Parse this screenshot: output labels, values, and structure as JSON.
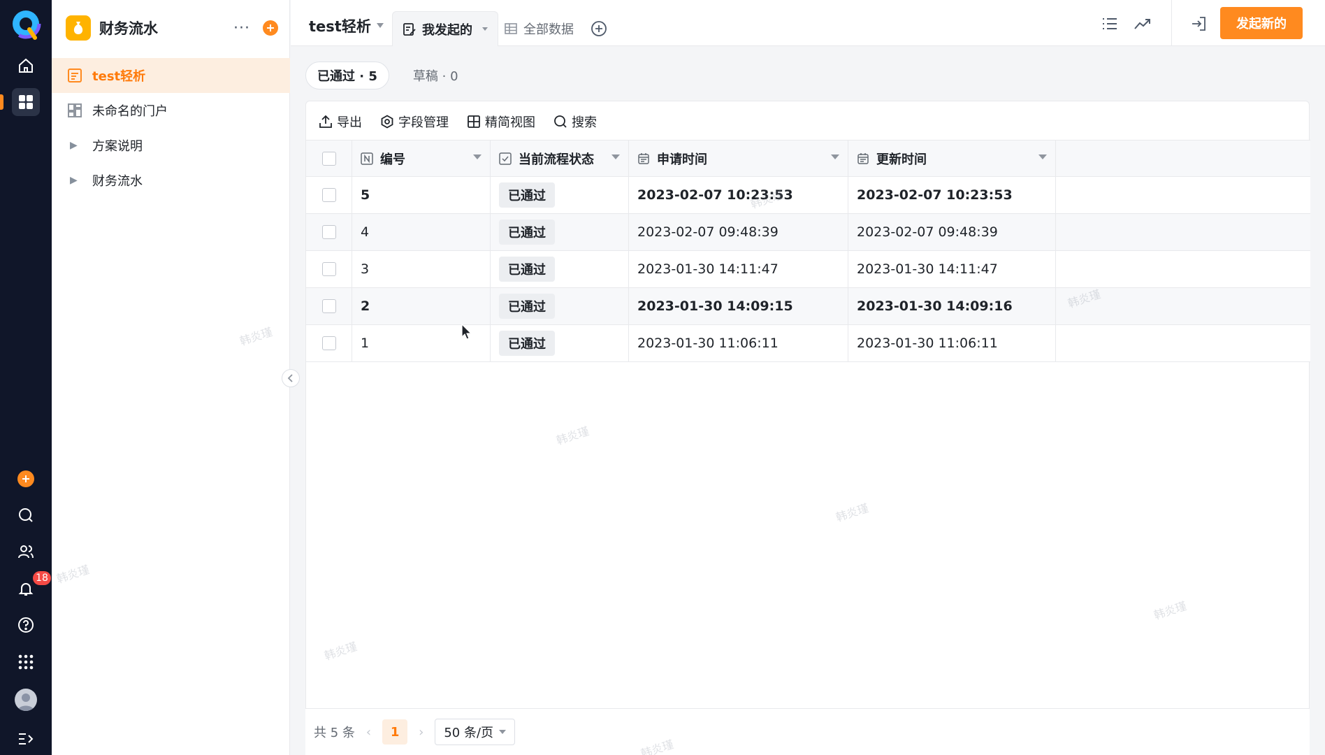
{
  "rail": {
    "notification_count": "18"
  },
  "nav": {
    "app_title": "财务流水",
    "items": [
      {
        "label": "test轻析"
      },
      {
        "label": "未命名的门户"
      },
      {
        "label": "方案说明"
      },
      {
        "label": "财务流水"
      }
    ]
  },
  "topbar": {
    "form_name": "test轻析",
    "tabs": [
      {
        "label": "我发起的"
      },
      {
        "label": "全部数据"
      }
    ],
    "primary_button": "发起新的"
  },
  "filters": [
    {
      "label": "已通过 · 5"
    },
    {
      "label": "草稿 · 0"
    }
  ],
  "toolbar": {
    "export": "导出",
    "fields": "字段管理",
    "compact_view": "精简视图",
    "search": "搜索"
  },
  "table": {
    "columns": [
      "编号",
      "当前流程状态",
      "申请时间",
      "更新时间"
    ],
    "rows": [
      {
        "id": "5",
        "status": "已通过",
        "applied": "2023-02-07 10:23:53",
        "updated": "2023-02-07 10:23:53"
      },
      {
        "id": "4",
        "status": "已通过",
        "applied": "2023-02-07 09:48:39",
        "updated": "2023-02-07 09:48:39"
      },
      {
        "id": "3",
        "status": "已通过",
        "applied": "2023-01-30 14:11:47",
        "updated": "2023-01-30 14:11:47"
      },
      {
        "id": "2",
        "status": "已通过",
        "applied": "2023-01-30 14:09:15",
        "updated": "2023-01-30 14:09:16"
      },
      {
        "id": "1",
        "status": "已通过",
        "applied": "2023-01-30 11:06:11",
        "updated": "2023-01-30 11:06:11"
      }
    ]
  },
  "pagination": {
    "total": "共 5 条",
    "current_page": "1",
    "page_size": "50 条/页"
  },
  "watermark": "韩炎瑾",
  "colors": {
    "accent": "#ff8a1f",
    "rail_bg": "#101629",
    "active_bg": "#fdeee0",
    "badge": "#f54a45"
  }
}
